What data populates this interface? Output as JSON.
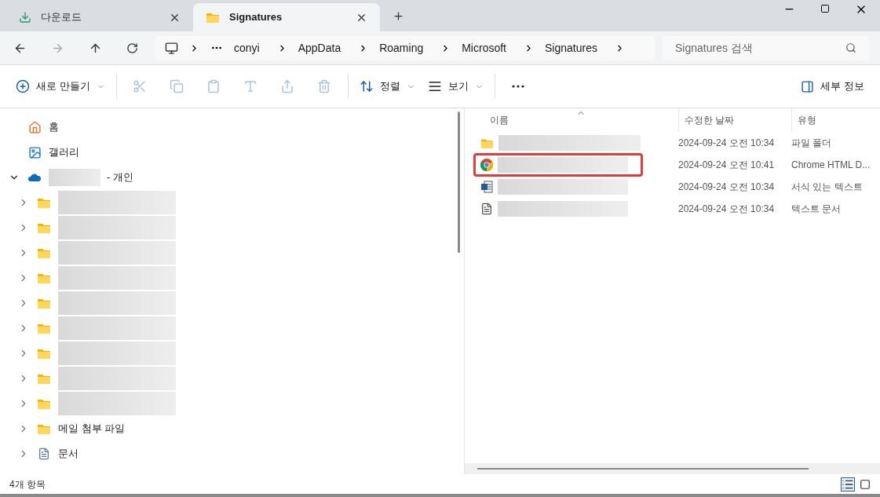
{
  "tabs": [
    {
      "kind": "download",
      "label": "다운로드",
      "selected": false
    },
    {
      "kind": "folder",
      "label": "Signatures",
      "selected": true
    }
  ],
  "breadcrumb": [
    "conyi",
    "AppData",
    "Roaming",
    "Microsoft",
    "Signatures"
  ],
  "search": {
    "placeholder": "Signatures 검색"
  },
  "toolbar": [
    {
      "kind": "new",
      "label": "새로 만들기",
      "disabled": false
    },
    {
      "kind": "cut",
      "disabled": true
    },
    {
      "kind": "copy",
      "disabled": true
    },
    {
      "kind": "paste",
      "disabled": true
    },
    {
      "kind": "rename",
      "disabled": true
    },
    {
      "kind": "share",
      "disabled": true
    },
    {
      "kind": "delete",
      "disabled": true
    },
    {
      "kind": "sort",
      "label": "정렬",
      "disabled": false
    },
    {
      "kind": "view",
      "label": "보기",
      "disabled": false
    },
    {
      "kind": "more",
      "disabled": false
    }
  ],
  "details_button": "세부 정보",
  "sidebar": {
    "items": [
      {
        "kind": "home",
        "label": "홈"
      },
      {
        "kind": "gallery",
        "label": "갤러리"
      },
      {
        "kind": "cloud",
        "label": "- 개인",
        "expanded": true,
        "children": [
          {
            "kind": "folder",
            "expanded": false
          },
          {
            "kind": "folder",
            "expanded": false
          },
          {
            "kind": "folder",
            "expanded": false
          },
          {
            "kind": "folder",
            "expanded": false
          },
          {
            "kind": "folder",
            "expanded": false
          },
          {
            "kind": "folder",
            "expanded": false
          },
          {
            "kind": "folder",
            "expanded": false
          },
          {
            "kind": "folder",
            "expanded": false
          },
          {
            "kind": "folder",
            "expanded": false
          },
          {
            "kind": "folder",
            "label": "메일 첨부 파일",
            "expanded": false
          },
          {
            "kind": "documents",
            "label": "문서",
            "expanded": false
          }
        ]
      }
    ]
  },
  "table": {
    "columns": [
      "이름",
      "수정한 날짜",
      "유형"
    ],
    "rows": [
      {
        "kind": "folder",
        "date": "2024-09-24 오전 10:34",
        "type": "파일 폴더",
        "highlighted": false
      },
      {
        "kind": "chrome",
        "date": "2024-09-24 오전 10:41",
        "type": "Chrome HTML D...",
        "highlighted": true
      },
      {
        "kind": "word",
        "date": "2024-09-24 오전 10:34",
        "type": "서식 있는 텍스트",
        "highlighted": false
      },
      {
        "kind": "text",
        "date": "2024-09-24 오전 10:34",
        "type": "텍스트 문서",
        "highlighted": false
      }
    ]
  },
  "status_bar": {
    "count": "4개 항목"
  }
}
